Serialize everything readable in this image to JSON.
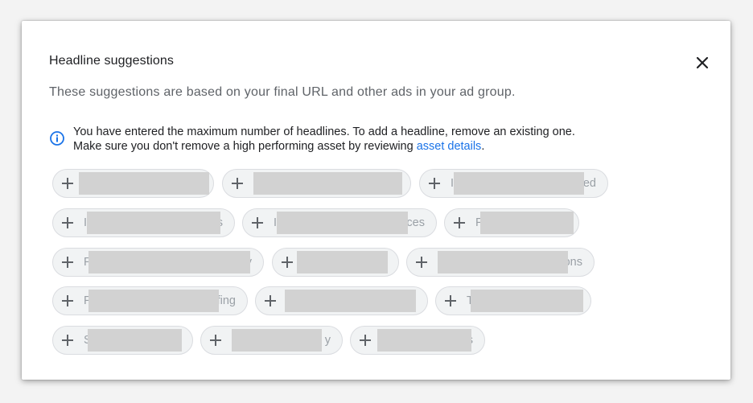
{
  "dialog": {
    "title": "Headline suggestions",
    "subtitle": "These suggestions are based on your final URL and other ads in your ad group.",
    "info": {
      "line1": "You have entered the maximum number of headlines. To add a headline, remove an existing one.",
      "line2_prefix": "Make sure you don't remove a high performing asset by reviewing ",
      "link": "asset details",
      "line2_suffix": "."
    },
    "close_icon": "close-icon",
    "info_icon": "info-icon"
  },
  "suggestions": [
    {
      "first": "",
      "last": ""
    },
    {
      "first": "",
      "last": ""
    },
    {
      "first": "I",
      "last": "ed"
    },
    {
      "first": "I",
      "last": "s"
    },
    {
      "first": "I",
      "last": "ces"
    },
    {
      "first": "F",
      "last": ""
    },
    {
      "first": "F",
      "last": "y"
    },
    {
      "first": "",
      "last": ""
    },
    {
      "first": "",
      "last": "ons"
    },
    {
      "first": "F",
      "last": "fing"
    },
    {
      "first": "",
      "last": ""
    },
    {
      "first": "T",
      "last": ""
    },
    {
      "first": "S",
      "last": ""
    },
    {
      "first": "",
      "last": "y"
    },
    {
      "first": "",
      "last": "s"
    }
  ],
  "colors": {
    "accent": "#1a73e8",
    "chip_bg": "#f1f3f4",
    "redaction": "#d2d2d2"
  }
}
